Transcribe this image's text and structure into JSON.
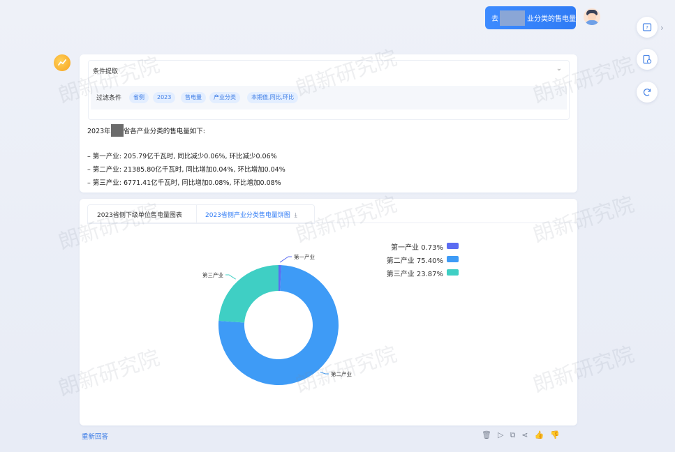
{
  "user": {
    "message_prefix": "去",
    "message_suffix": "业分类的售电量"
  },
  "side": {
    "icons": [
      "help-doc-icon",
      "file-settings-icon",
      "refresh-icon"
    ]
  },
  "conditions": {
    "title": "条件提取",
    "filter_label": "过滤条件",
    "tags": [
      "省侧",
      "2023",
      "售电量",
      "产业分类",
      "本期值,同比,环比"
    ]
  },
  "summary": {
    "intro_prefix": "2023年",
    "intro_suffix": "省各产业分类的售电量如下:",
    "lines": [
      "– 第一产业: 205.79亿千瓦时, 同比减少0.06%, 环比减少0.06%",
      "– 第二产业: 21385.80亿千瓦时, 同比增加0.04%, 环比增加0.04%",
      "– 第三产业: 6771.41亿千瓦时, 同比增加0.08%, 环比增加0.08%"
    ]
  },
  "tabs": [
    "2023省侧下级单位售电量图表",
    "2023省侧产业分类售电量饼图"
  ],
  "chart_data": {
    "type": "pie",
    "categories": [
      "第一产业",
      "第二产业",
      "第三产业"
    ],
    "values": [
      0.73,
      75.4,
      23.87
    ],
    "percent_labels": [
      "0.73%",
      "75.40%",
      "23.87%"
    ],
    "colors": [
      "#5b6cf2",
      "#3e9bf6",
      "#3fcfc4"
    ],
    "legend": "top-right",
    "donut": true
  },
  "footer": {
    "regenerate": "重新回答",
    "actions": [
      "trash-icon",
      "play-icon",
      "copy-icon",
      "share-icon",
      "thumbs-up-icon",
      "thumbs-down-icon"
    ]
  },
  "watermark": "朗新研究院"
}
